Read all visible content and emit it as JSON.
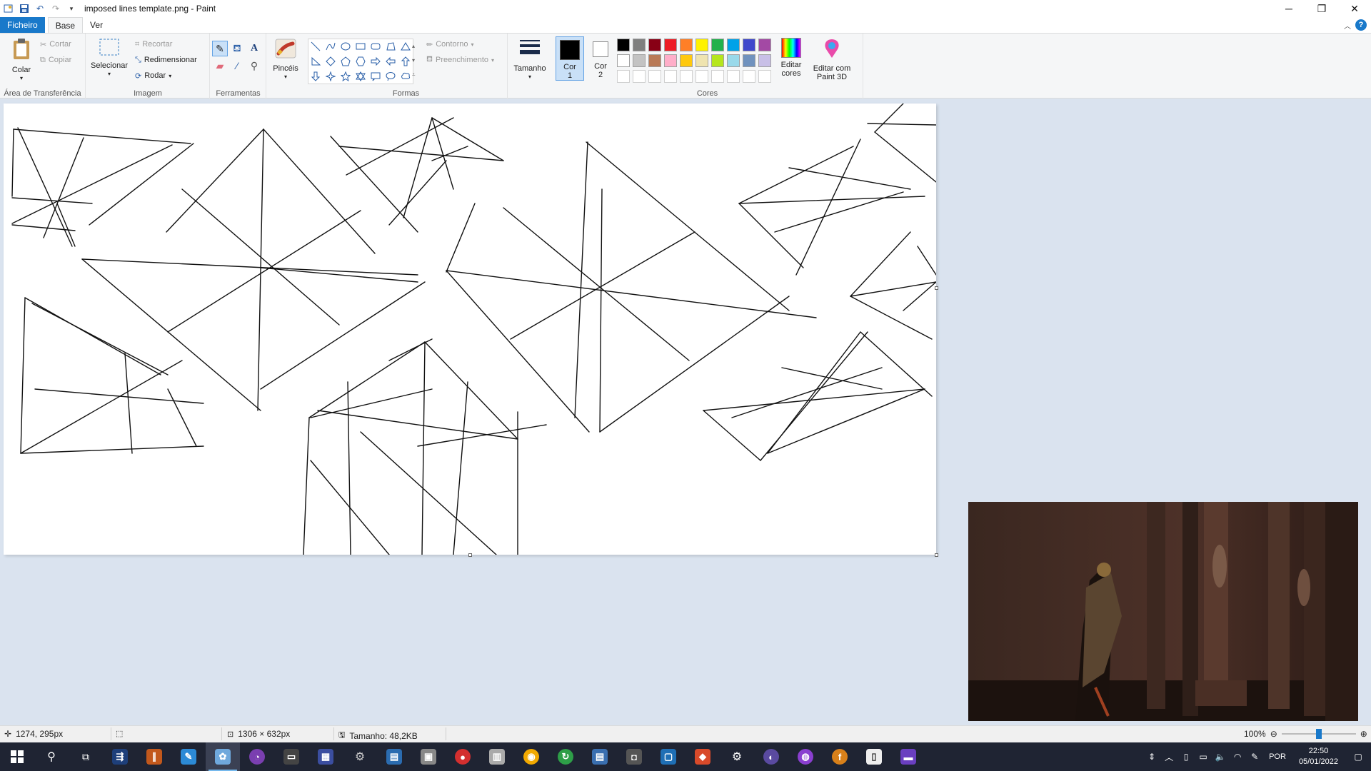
{
  "window": {
    "title": "imposed lines template.png - Paint",
    "controls": {
      "minimize": "─",
      "restore": "❐",
      "close": "✕"
    }
  },
  "tabs": {
    "file": "Ficheiro",
    "home": "Base",
    "view": "Ver"
  },
  "ribbon": {
    "clipboard": {
      "paste": "Colar",
      "cut": "Cortar",
      "copy": "Copiar",
      "label": "Área de Transferência"
    },
    "image": {
      "select": "Selecionar",
      "crop": "Recortar",
      "resize": "Redimensionar",
      "rotate": "Rodar",
      "label": "Imagem"
    },
    "tools": {
      "label": "Ferramentas"
    },
    "brushes": {
      "label": "Pincéis"
    },
    "shapes": {
      "outline": "Contorno",
      "fill": "Preenchimento",
      "label": "Formas"
    },
    "size": {
      "label": "Tamanho"
    },
    "colors": {
      "color1": "Cor",
      "color1_num": "1",
      "color2": "Cor",
      "color2_num": "2",
      "edit": "Editar",
      "edit2": "cores",
      "paint3d": "Editar com",
      "paint3d2": "Paint 3D",
      "label": "Cores",
      "palette": [
        "#000000",
        "#7f7f7f",
        "#880015",
        "#ed1c24",
        "#ff7f27",
        "#fff200",
        "#22b14c",
        "#00a2e8",
        "#3f48cc",
        "#a349a4",
        "#ffffff",
        "#c3c3c3",
        "#b97a57",
        "#ffaec9",
        "#ffc90e",
        "#efe4b0",
        "#b5e61d",
        "#99d9ea",
        "#7092be",
        "#c8bfe7",
        "#ffffff",
        "#ffffff",
        "#ffffff",
        "#ffffff",
        "#ffffff",
        "#ffffff",
        "#ffffff",
        "#ffffff",
        "#ffffff",
        "#ffffff"
      ]
    }
  },
  "status": {
    "cursor": "1274, 295px",
    "dimensions": "1306 × 632px",
    "size": "Tamanho: 48,2KB",
    "zoom": "100%"
  },
  "taskbar": {
    "language": "POR",
    "time": "22:50",
    "date": "05/01/2022"
  }
}
